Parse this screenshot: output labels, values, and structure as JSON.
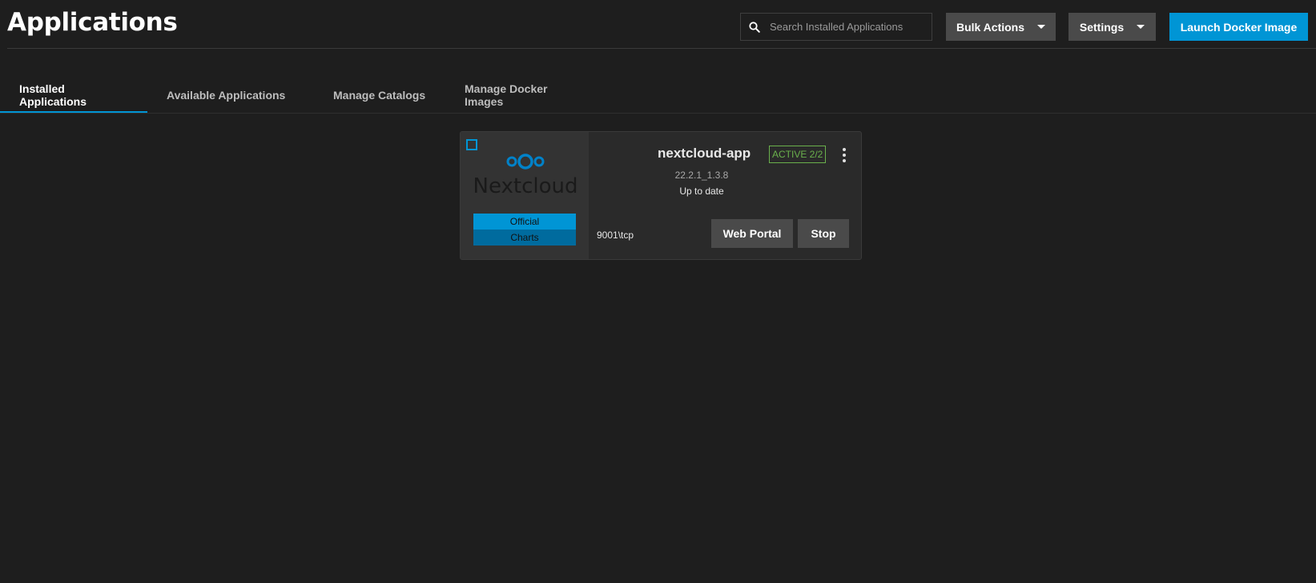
{
  "header": {
    "title": "Applications",
    "search": {
      "placeholder": "Search Installed Applications",
      "value": ""
    },
    "bulk_actions_label": "Bulk Actions",
    "settings_label": "Settings",
    "launch_label": "Launch Docker Image"
  },
  "tabs": [
    {
      "label": "Installed Applications",
      "active": true
    },
    {
      "label": "Available Applications",
      "active": false
    },
    {
      "label": "Manage Catalogs",
      "active": false
    },
    {
      "label": "Manage Docker Images",
      "active": false
    }
  ],
  "app_card": {
    "name": "nextcloud-app",
    "status": "ACTIVE 2/2",
    "version": "22.2.1_1.3.8",
    "update_status": "Up to date",
    "ports": "9001\\tcp",
    "logo_text": "Nextcloud",
    "badges": [
      "Official",
      "Charts"
    ],
    "web_portal_label": "Web Portal",
    "stop_label": "Stop"
  },
  "icons": {
    "search": "search-icon",
    "dropdown": "chevron-down-icon",
    "menu": "kebab-menu-icon",
    "logo": "nextcloud-logo-icon"
  },
  "colors": {
    "background": "#1e1e1e",
    "accent": "#0095d5",
    "button_grey": "#4a4a4a",
    "status_active": "#6ab04c",
    "badge_dark": "#006b9e"
  }
}
